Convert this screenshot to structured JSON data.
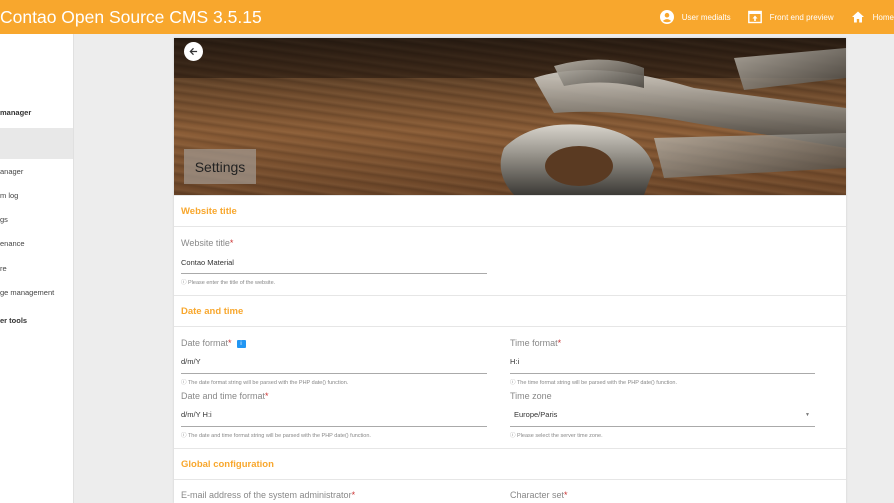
{
  "header": {
    "title": "Contao Open Source CMS 3.5.15",
    "links": [
      {
        "label": "User medialts",
        "icon": "account-circle-icon"
      },
      {
        "label": "Front end preview",
        "icon": "preview-icon"
      },
      {
        "label": "Home",
        "icon": "home-icon"
      }
    ]
  },
  "sidebar": {
    "items": [
      {
        "label": "manager",
        "bold": true
      },
      {
        "label": "anager",
        "bold": false
      },
      {
        "label": "m log",
        "bold": false
      },
      {
        "label": "gs",
        "bold": false
      },
      {
        "label": "enance",
        "bold": false
      },
      {
        "label": "re",
        "bold": false
      },
      {
        "label": "ge management",
        "bold": false
      },
      {
        "label": "er tools",
        "bold": true
      }
    ]
  },
  "page": {
    "title": "Settings",
    "back_icon": "arrow-left-icon"
  },
  "sections": {
    "website": {
      "heading": "Website title",
      "title_label": "Website title",
      "title_value": "Contao Material",
      "title_hint": "Please enter the title of the website."
    },
    "datetime": {
      "heading": "Date and time",
      "date_label": "Date format",
      "date_value": "d/m/Y",
      "date_hint": "The date format string will be parsed with the PHP date() function.",
      "time_label": "Time format",
      "time_value": "H:i",
      "time_hint": "The time format string will be parsed with the PHP date() function.",
      "datim_label": "Date and time format",
      "datim_value": "d/m/Y H:i",
      "datim_hint": "The date and time format string will be parsed with the PHP date() function.",
      "zone_label": "Time zone",
      "zone_value": "Europe/Paris",
      "zone_hint": "Please select the server time zone.",
      "info_badge": "i"
    },
    "global": {
      "heading": "Global configuration",
      "email_label": "E-mail address of the system administrator",
      "charset_label": "Character set"
    }
  },
  "required_mark": "*",
  "colors": {
    "accent": "#f8a72d",
    "required": "#cc3333",
    "info": "#2196f3"
  }
}
